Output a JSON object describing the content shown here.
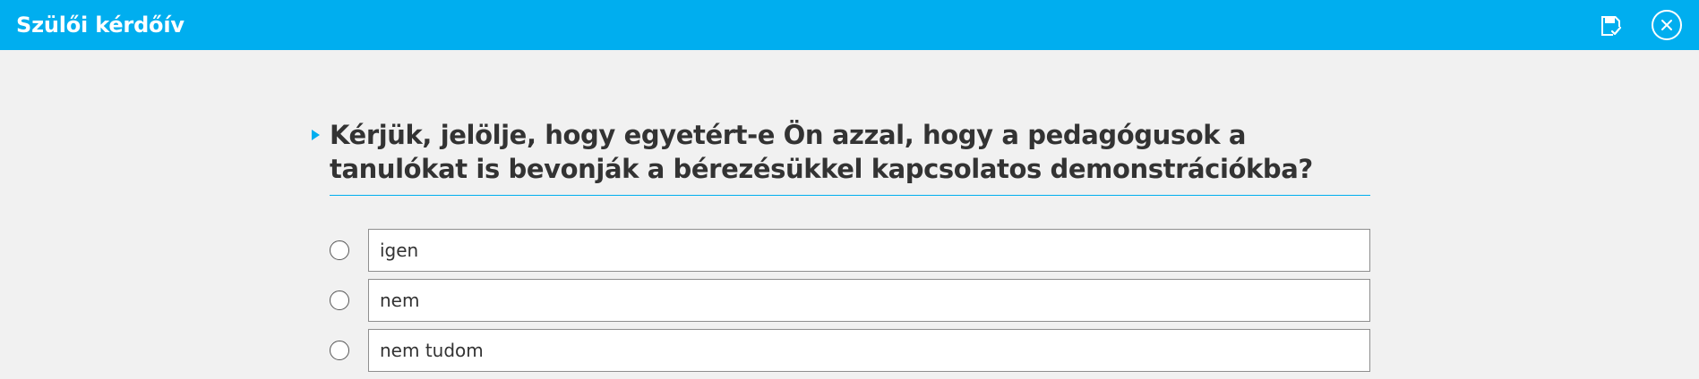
{
  "header": {
    "title": "Szülői kérdőív",
    "save_icon": "save-check-icon",
    "close_icon": "close-circle-icon",
    "background_color": "#00aeef"
  },
  "question": {
    "text": "Kérjük, jelölje, hogy egyetért-e Ön azzal, hogy a pedagógusok a tanulókat is bevonják a bérezésükkel kapcsolatos demonstrációkba?",
    "accent_color": "#00aeef"
  },
  "options": [
    {
      "label": "igen"
    },
    {
      "label": "nem"
    },
    {
      "label": "nem tudom"
    }
  ]
}
